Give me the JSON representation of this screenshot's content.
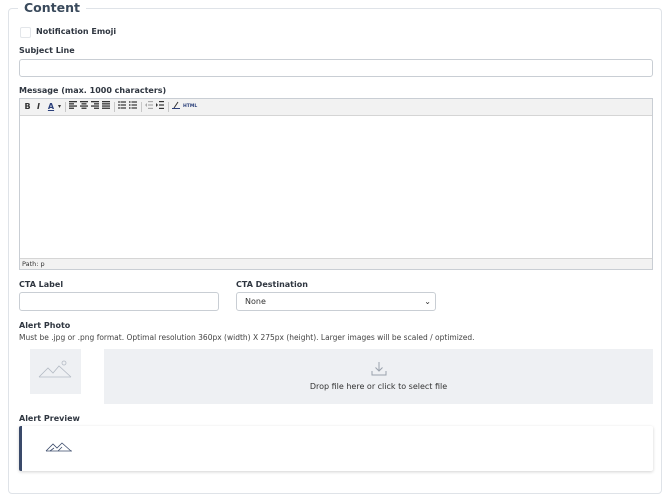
{
  "section": {
    "legend": "Content"
  },
  "notification_emoji": {
    "label": "Notification Emoji"
  },
  "subject_line": {
    "label": "Subject Line",
    "value": ""
  },
  "message": {
    "label": "Message (max. 1000 characters)",
    "toolbar": {
      "bold": "B",
      "italic": "I",
      "font_color": "A",
      "html": "HTML"
    },
    "status_path": "Path: p"
  },
  "cta_label": {
    "label": "CTA Label",
    "value": ""
  },
  "cta_destination": {
    "label": "CTA Destination",
    "selected": "None"
  },
  "alert_photo": {
    "label": "Alert Photo",
    "hint": "Must be .jpg or .png format. Optimal resolution 360px (width) X 275px (height). Larger images will be scaled / optimized.",
    "drop_text": "Drop file here or click to select file"
  },
  "alert_preview": {
    "label": "Alert Preview"
  },
  "colors": {
    "accent": "#3a4a6a",
    "border": "#c9ced4",
    "panel": "#eef0f3"
  }
}
